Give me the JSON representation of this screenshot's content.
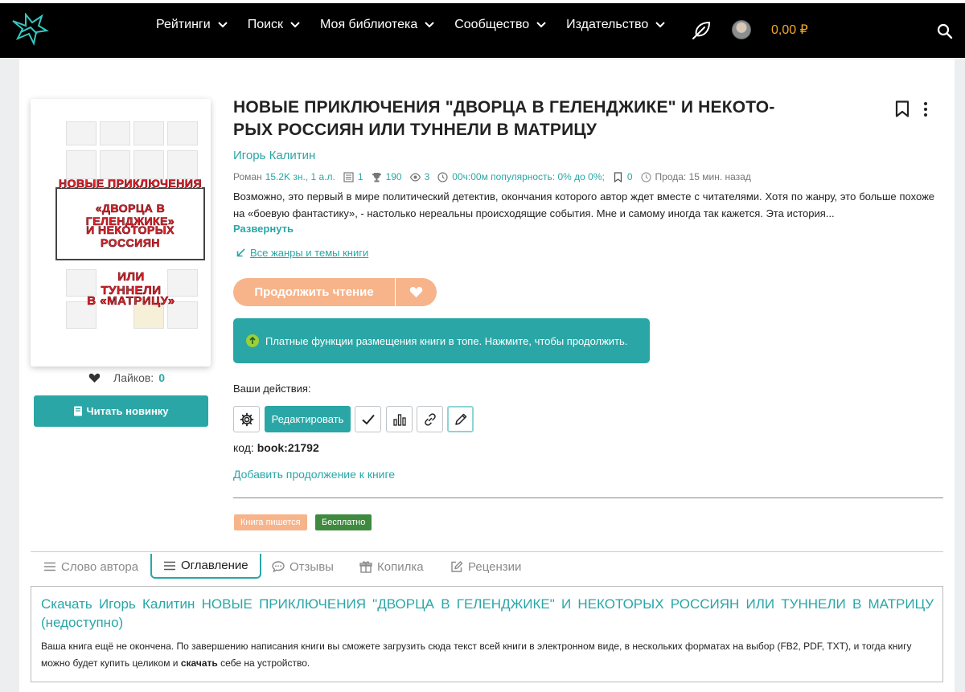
{
  "header": {
    "nav": [
      "Рейтинги",
      "Поиск",
      "Моя библиотека",
      "Сообщество",
      "Издательство"
    ],
    "balance": "0,00 ₽"
  },
  "book": {
    "title": "НОВЫЕ ПРИКЛЮЧЕНИЯ \"ДВОРЦА В ГЕЛЕНДЖИКЕ\" И НЕКОТО­РЫХ РОССИЯН ИЛИ ТУННЕЛИ В МАТРИЦУ",
    "author": "Игорь Калитин",
    "cover_text": {
      "line1": "НОВЫЕ ПРИКЛЮЧЕНИЯ",
      "line2": "«ДВОРЦА В ГЕЛЕНДЖИКЕ»",
      "line3": "И НЕКОТОРЫХ РОССИЯН",
      "line4": "ИЛИ ТУННЕЛИ",
      "line5": "В «МАТРИЦУ»"
    },
    "meta": {
      "genre": "Роман",
      "size": "15.2K зн., 1 а.л.",
      "parts": "1",
      "trophy": "190",
      "views": "3",
      "popularity": "00ч:00м популярность: 0% до 0%;",
      "bookmarks": "0",
      "sale": "Продa: 15 мин. назад"
    },
    "annotation": "Возможно, это первый в мире политический детектив, окончания которого автор ждет вместе с читателями. Хотя по жанру, это больше по­хоже на «боевую фантастику», - настолько нереальны происходящие события. Мне и самому иногда так кажется. Эта история...",
    "expand": "Развернуть",
    "genres_link": "Все жанры и темы книги",
    "likes_label": "Лайков:",
    "likes_count": "0",
    "read_new": "Читать новинку",
    "code_label": "код:",
    "code_value": "book:21792",
    "add_continuation": "Добавить продолжение к книге",
    "badge_writing": "Книга пишется",
    "badge_free": "Бесплатно"
  },
  "buttons": {
    "continue": "Продолжить чтение",
    "promo": "Платные функции размещения книги в топе. Нажмите, чтобы продолжить.",
    "actions_label": "Ваши действия:",
    "edit": "Редактировать"
  },
  "tabs": [
    "Слово автора",
    "Оглавление",
    "Отзывы",
    "Копилка",
    "Рецензии"
  ],
  "download": {
    "title": "Скачать Игорь Калитин НОВЫЕ ПРИКЛЮЧЕНИЯ \"ДВОРЦА В ГЕЛЕНДЖИКЕ\" И НЕКОТОРЫХ РОССИЯН ИЛИ ТУННЕЛИ В МАТРИЦУ (недоступно)",
    "text_before": "Ваша книга ещё не окончена. По завершению написания книги вы сможете загрузить сюда текст всей книги в электронном виде, в нескольких форматах на выбор (FB2, PDF, TXT), и тогда книгу можно будет купить целиком и ",
    "text_bold": "скачать",
    "text_after": " себе на устройство."
  },
  "colors": {
    "accent": "#2aa6a6",
    "orange": "#f7b48a",
    "balance": "#f5a623",
    "free_badge": "#3f8a3f"
  }
}
